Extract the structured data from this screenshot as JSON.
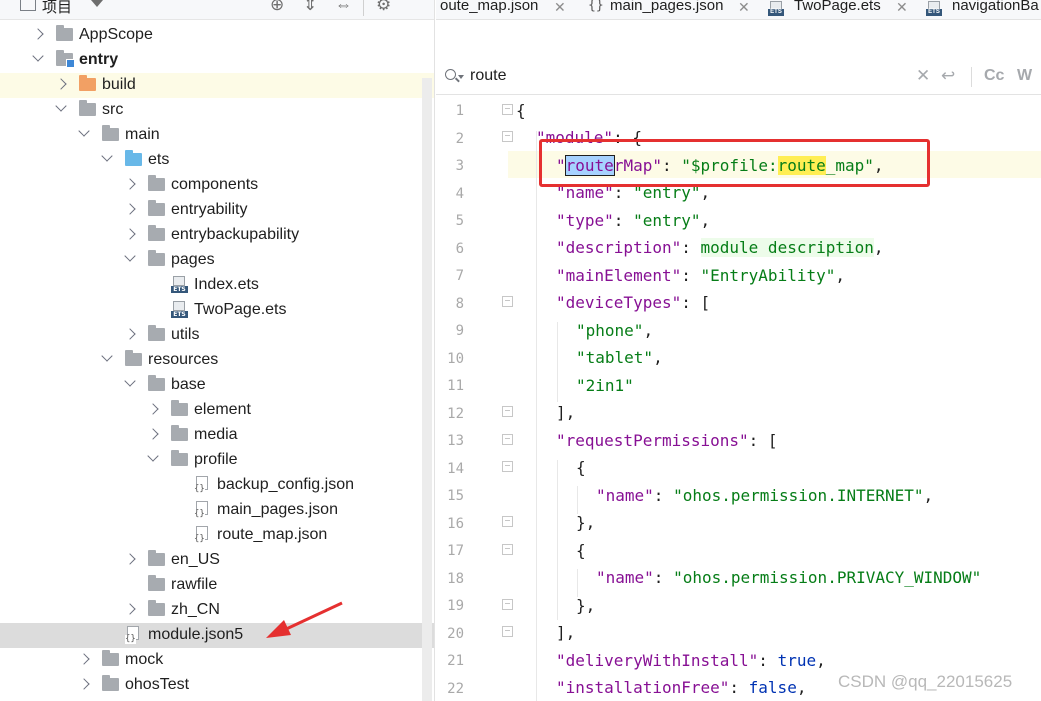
{
  "project_panel": {
    "title": "项目",
    "tree": [
      {
        "label": "AppScope",
        "depth": 0,
        "icon": "folder-icon",
        "expanded": false,
        "bold": false
      },
      {
        "label": "entry",
        "depth": 0,
        "icon": "module-folder-icon",
        "expanded": true,
        "bold": true
      },
      {
        "label": "build",
        "depth": 1,
        "icon": "orange-folder-icon",
        "expanded": false,
        "bold": false
      },
      {
        "label": "src",
        "depth": 1,
        "icon": "folder-icon",
        "expanded": true,
        "bold": false
      },
      {
        "label": "main",
        "depth": 2,
        "icon": "folder-icon",
        "expanded": true,
        "bold": false
      },
      {
        "label": "ets",
        "depth": 3,
        "icon": "blue-folder-icon",
        "expanded": true,
        "bold": false
      },
      {
        "label": "components",
        "depth": 4,
        "icon": "folder-icon",
        "expanded": false,
        "bold": false
      },
      {
        "label": "entryability",
        "depth": 4,
        "icon": "folder-icon",
        "expanded": false,
        "bold": false
      },
      {
        "label": "entrybackupability",
        "depth": 4,
        "icon": "folder-icon",
        "expanded": false,
        "bold": false
      },
      {
        "label": "pages",
        "depth": 4,
        "icon": "folder-icon",
        "expanded": true,
        "bold": false
      },
      {
        "label": "Index.ets",
        "depth": 5,
        "icon": "ets-file-icon",
        "expanded": null,
        "bold": false
      },
      {
        "label": "TwoPage.ets",
        "depth": 5,
        "icon": "ets-file-icon",
        "expanded": null,
        "bold": false
      },
      {
        "label": "utils",
        "depth": 4,
        "icon": "folder-icon",
        "expanded": false,
        "bold": false
      },
      {
        "label": "resources",
        "depth": 3,
        "icon": "folder-icon",
        "expanded": true,
        "bold": false
      },
      {
        "label": "base",
        "depth": 4,
        "icon": "folder-icon",
        "expanded": true,
        "bold": false
      },
      {
        "label": "element",
        "depth": 5,
        "icon": "folder-icon",
        "expanded": false,
        "bold": false
      },
      {
        "label": "media",
        "depth": 5,
        "icon": "folder-icon",
        "expanded": false,
        "bold": false
      },
      {
        "label": "profile",
        "depth": 5,
        "icon": "folder-icon",
        "expanded": true,
        "bold": false
      },
      {
        "label": "backup_config.json",
        "depth": 6,
        "icon": "json-file-icon",
        "expanded": null,
        "bold": false
      },
      {
        "label": "main_pages.json",
        "depth": 6,
        "icon": "json-file-icon",
        "expanded": null,
        "bold": false
      },
      {
        "label": "route_map.json",
        "depth": 6,
        "icon": "json-file-icon",
        "expanded": null,
        "bold": false
      },
      {
        "label": "en_US",
        "depth": 4,
        "icon": "folder-icon",
        "expanded": false,
        "bold": false
      },
      {
        "label": "rawfile",
        "depth": 4,
        "icon": "folder-icon",
        "expanded": null,
        "bold": false
      },
      {
        "label": "zh_CN",
        "depth": 4,
        "icon": "folder-icon",
        "expanded": false,
        "bold": false
      },
      {
        "label": "module.json5",
        "depth": 3,
        "icon": "json-file-icon",
        "expanded": null,
        "bold": false,
        "selected": true
      },
      {
        "label": "mock",
        "depth": 2,
        "icon": "folder-icon",
        "expanded": false,
        "bold": false
      },
      {
        "label": "ohosTest",
        "depth": 2,
        "icon": "folder-icon",
        "expanded": false,
        "bold": false
      }
    ]
  },
  "tabs": [
    {
      "label": "oute_map.json",
      "icon": "json-file-icon",
      "closable": true
    },
    {
      "label": "main_pages.json",
      "icon": "json-file-icon",
      "closable": true
    },
    {
      "label": "TwoPage.ets",
      "icon": "ets-file-icon",
      "closable": true
    },
    {
      "label": "navigationBa",
      "icon": "ets-file-icon",
      "closable": false
    }
  ],
  "search": {
    "query": "route",
    "buttons": {
      "match_case": "Cc",
      "words": "W"
    }
  },
  "editor": {
    "line_numbers": [
      "1",
      "2",
      "3",
      "4",
      "5",
      "6",
      "7",
      "8",
      "9",
      "10",
      "11",
      "12",
      "13",
      "14",
      "15",
      "16",
      "17",
      "18",
      "19",
      "20",
      "21",
      "22"
    ],
    "current_line": 3
  },
  "annotation": {
    "color": "#e53030"
  },
  "watermark": "CSDN @qq_22015625",
  "colors": {
    "json_key": "#871094",
    "json_string": "#067d17",
    "json_keyword": "#0033b3",
    "selected_row": "#dcdcdc",
    "current_line": "#fdfbe6",
    "find_highlight": "#ffee53",
    "selection": "#a6d2ff"
  }
}
